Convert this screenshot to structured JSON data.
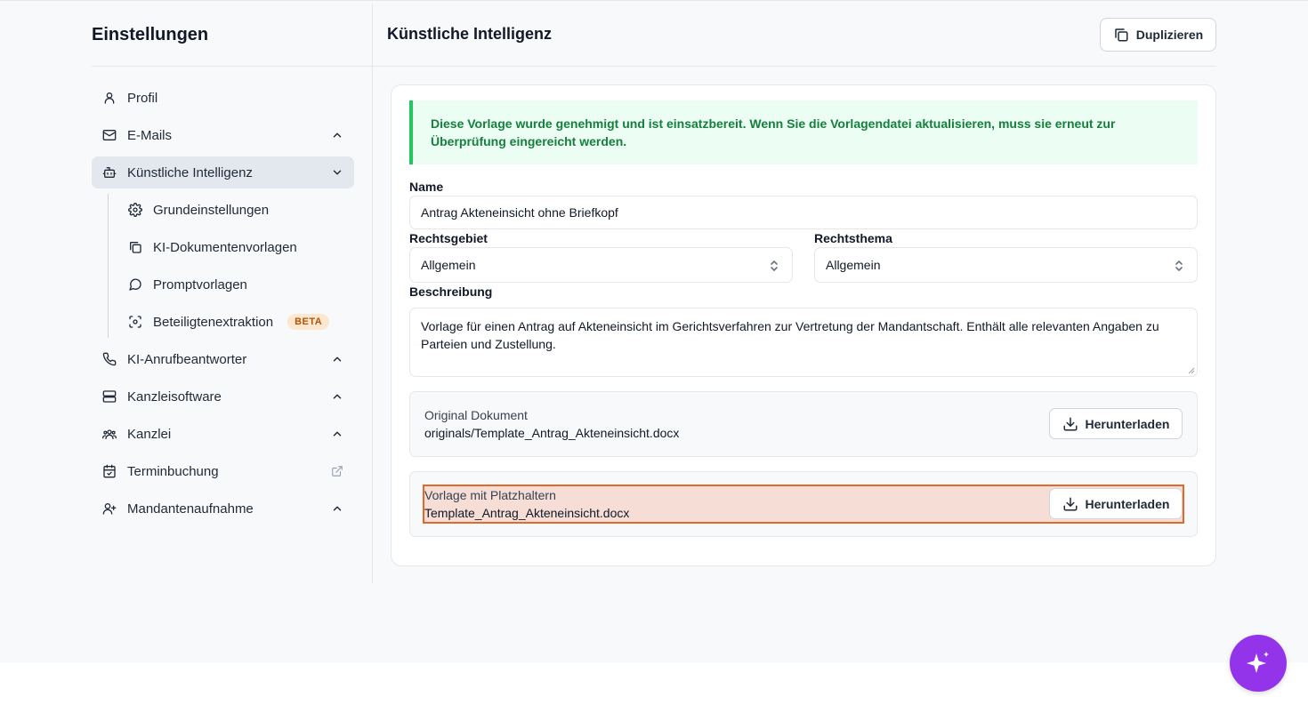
{
  "sidebar": {
    "title": "Einstellungen",
    "items": [
      {
        "label": "Profil",
        "icon": "user-icon"
      },
      {
        "label": "E-Mails",
        "icon": "mail-icon"
      },
      {
        "label": "Künstliche Intelligenz",
        "icon": "bot-icon"
      },
      {
        "label": "KI-Anrufbeantworter",
        "icon": "phone-icon"
      },
      {
        "label": "Kanzleisoftware",
        "icon": "server-icon"
      },
      {
        "label": "Kanzlei",
        "icon": "users-icon"
      },
      {
        "label": "Terminbuchung",
        "icon": "calendar-check-icon"
      },
      {
        "label": "Mandantenaufnahme",
        "icon": "user-plus-icon"
      }
    ],
    "subitems": [
      {
        "label": "Grundeinstellungen",
        "icon": "gear-icon"
      },
      {
        "label": "KI-Dokumentenvorlagen",
        "icon": "copy-icon"
      },
      {
        "label": "Promptvorlagen",
        "icon": "message-circle-icon"
      },
      {
        "label": "Beteiligtenextraktion",
        "icon": "scan-face-icon",
        "badge": "BETA"
      }
    ]
  },
  "header": {
    "title": "Künstliche Intelligenz",
    "duplicate_label": "Duplizieren"
  },
  "form": {
    "alert": "Diese Vorlage wurde genehmigt und ist einsatzbereit. Wenn Sie die Vorlagendatei aktualisieren, muss sie erneut zur Überprüfung eingereicht werden.",
    "name_label": "Name",
    "name_value": "Antrag Akteneinsicht ohne Briefkopf",
    "rechtsgebiet_label": "Rechtsgebiet",
    "rechtsgebiet_value": "Allgemein",
    "rechtsthema_label": "Rechtsthema",
    "rechtsthema_value": "Allgemein",
    "beschreibung_label": "Beschreibung",
    "beschreibung_value": "Vorlage für einen Antrag auf Akteneinsicht im Gerichtsverfahren zur Vertretung der Mandantschaft. Enthält alle relevanten Angaben zu Parteien und Zustellung."
  },
  "documents": {
    "original_title": "Original Dokument",
    "original_file": "originals/Template_Antrag_Akteneinsicht.docx",
    "template_title": "Vorlage mit Platzhaltern",
    "template_file": "Template_Antrag_Akteneinsicht.docx",
    "download_label": "Herunterladen"
  },
  "colors": {
    "accent": "#9333ea",
    "success_text": "#15803d",
    "success_bg": "#ecfdf3",
    "highlight": "#e06a2c"
  }
}
